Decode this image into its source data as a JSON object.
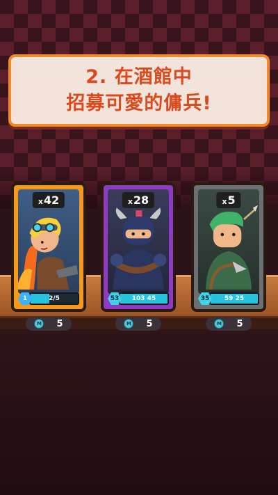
{
  "banner": {
    "line1": "2. 在酒館中",
    "line2": "招募可愛的傭兵!"
  },
  "cards": [
    {
      "count": "42",
      "level": "1",
      "progress_text": "2/5",
      "progress": 0.4,
      "price": "5",
      "frame_color": "#f39a1c"
    },
    {
      "count": "28",
      "level": "53",
      "progress_text": "103 45",
      "progress": 1.0,
      "price": "5",
      "frame_color": "#8e3bc1"
    },
    {
      "count": "5",
      "level": "35",
      "progress_text": "59 25",
      "progress": 1.0,
      "price": "5",
      "frame_color": "#6d6f73"
    }
  ],
  "currency_icon": "gem-coin-icon",
  "colors": {
    "banner_text": "#d94a1f",
    "banner_border": "#f08a2a",
    "progress_fill": "#27c3dc"
  }
}
